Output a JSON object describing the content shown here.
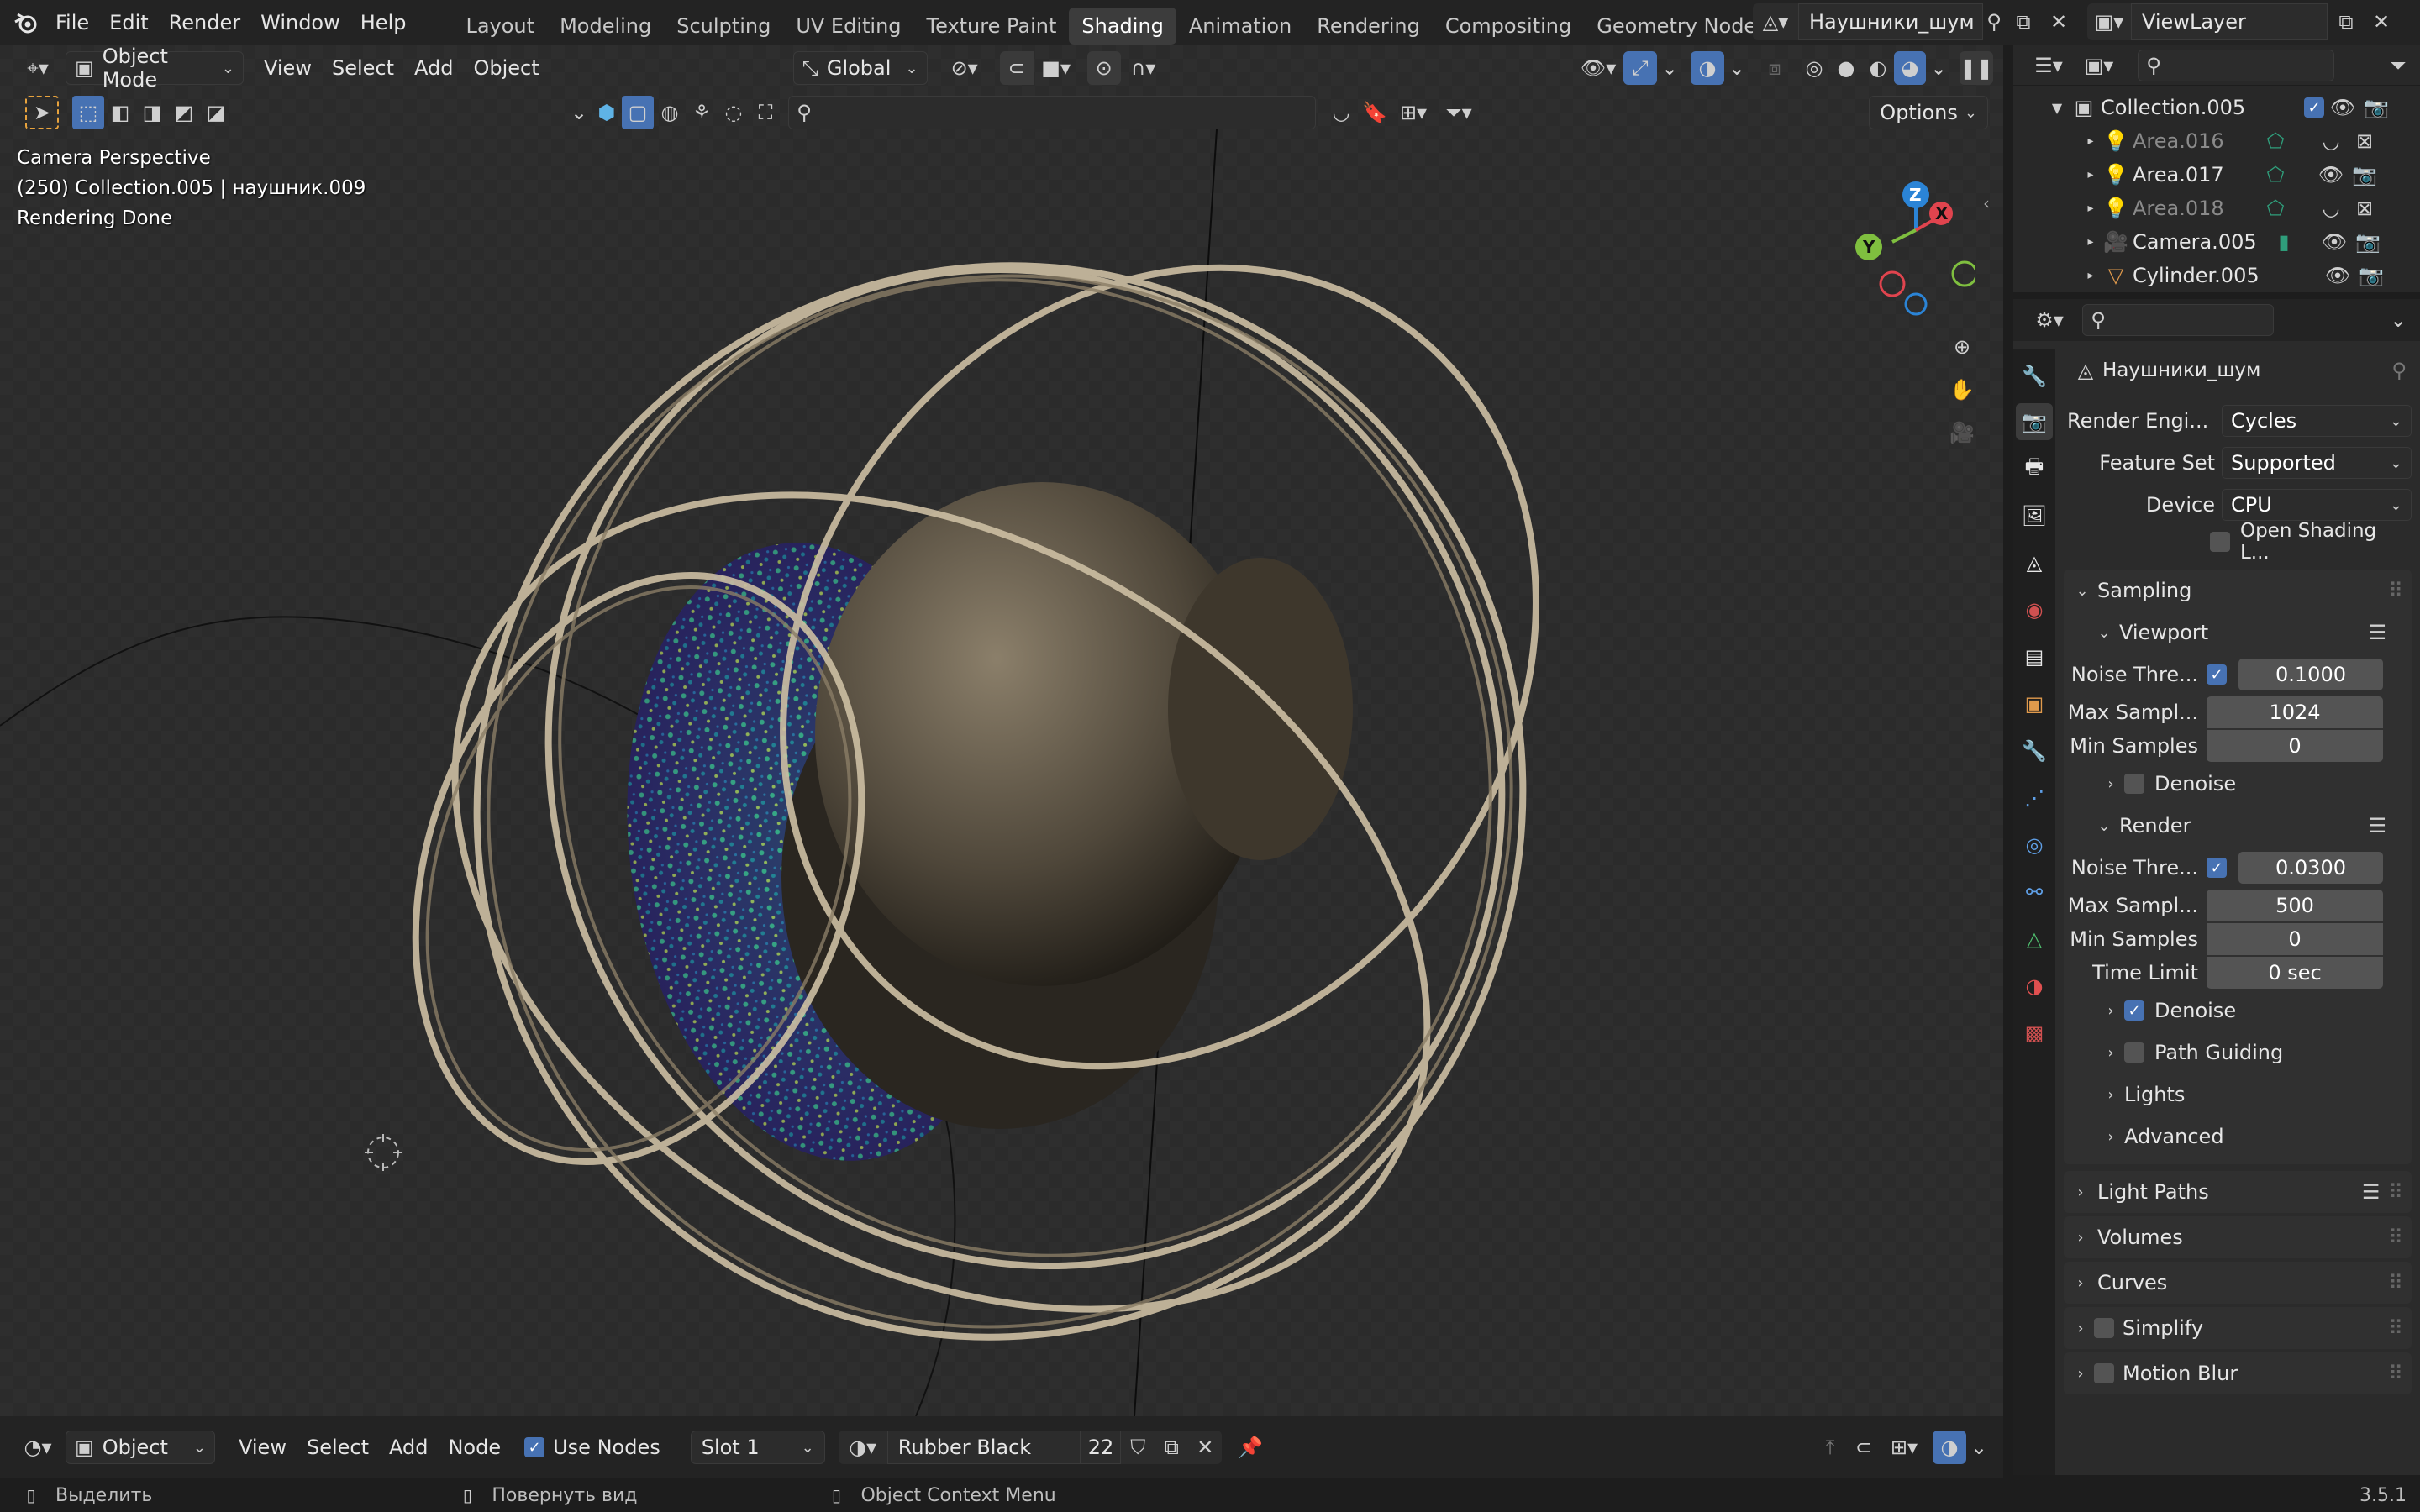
{
  "topbar": {
    "menus": [
      "File",
      "Edit",
      "Render",
      "Window",
      "Help"
    ],
    "workspaces": [
      "Layout",
      "Modeling",
      "Sculpting",
      "UV Editing",
      "Texture Paint",
      "Shading",
      "Animation",
      "Rendering",
      "Compositing",
      "Geometry Nodes"
    ],
    "active_workspace": "Shading",
    "scene_name": "Наушники_шум",
    "view_layer": "ViewLayer"
  },
  "viewport_header": {
    "mode": "Object Mode",
    "menus": [
      "View",
      "Select",
      "Add",
      "Object"
    ],
    "orientation": "Global",
    "options": "Options"
  },
  "viewport_overlay": {
    "line1": "Camera Perspective",
    "line2": "(250) Collection.005 | наушник.009",
    "line3": "Rendering Done"
  },
  "gizmo": {
    "z": "Z",
    "y": "Y",
    "x": "X"
  },
  "outliner": {
    "items": [
      {
        "name": "Collection.005",
        "type": "collection"
      },
      {
        "name": "Area.016",
        "type": "light"
      },
      {
        "name": "Area.017",
        "type": "light"
      },
      {
        "name": "Area.018",
        "type": "light"
      },
      {
        "name": "Camera.005",
        "type": "camera"
      },
      {
        "name": "Cylinder.005",
        "type": "mesh"
      }
    ]
  },
  "properties": {
    "scene_name": "Наушники_шум",
    "render_engine_label": "Render Engi...",
    "render_engine": "Cycles",
    "feature_set_label": "Feature Set",
    "feature_set": "Supported",
    "device_label": "Device",
    "device": "CPU",
    "osl_label": "Open Shading L...",
    "sampling": "Sampling",
    "viewport": "Viewport",
    "vp_noise_label": "Noise Thre...",
    "vp_noise": "0.1000",
    "vp_max_label": "Max Sampl...",
    "vp_max": "1024",
    "vp_min_label": "Min Samples",
    "vp_min": "0",
    "vp_denoise": "Denoise",
    "render": "Render",
    "r_noise_label": "Noise Thre...",
    "r_noise": "0.0300",
    "r_max_label": "Max Sampl...",
    "r_max": "500",
    "r_min_label": "Min Samples",
    "r_min": "0",
    "r_time_label": "Time Limit",
    "r_time": "0 sec",
    "r_denoise": "Denoise",
    "path_guiding": "Path Guiding",
    "lights": "Lights",
    "advanced": "Advanced",
    "light_paths": "Light Paths",
    "volumes": "Volumes",
    "curves": "Curves",
    "simplify": "Simplify",
    "motion_blur": "Motion Blur"
  },
  "bottom_header": {
    "editor_mode": "Object",
    "menus": [
      "View",
      "Select",
      "Add",
      "Node"
    ],
    "use_nodes": "Use Nodes",
    "slot": "Slot 1",
    "material": "Rubber Black",
    "users": "22"
  },
  "statusbar": {
    "left_action": "Выделить",
    "mid_action": "Повернуть вид",
    "context": "Object Context Menu",
    "version": "3.5.1"
  },
  "colors": {
    "accent": "#4772b3",
    "header": "#232323",
    "panel": "#2b2b2b"
  }
}
